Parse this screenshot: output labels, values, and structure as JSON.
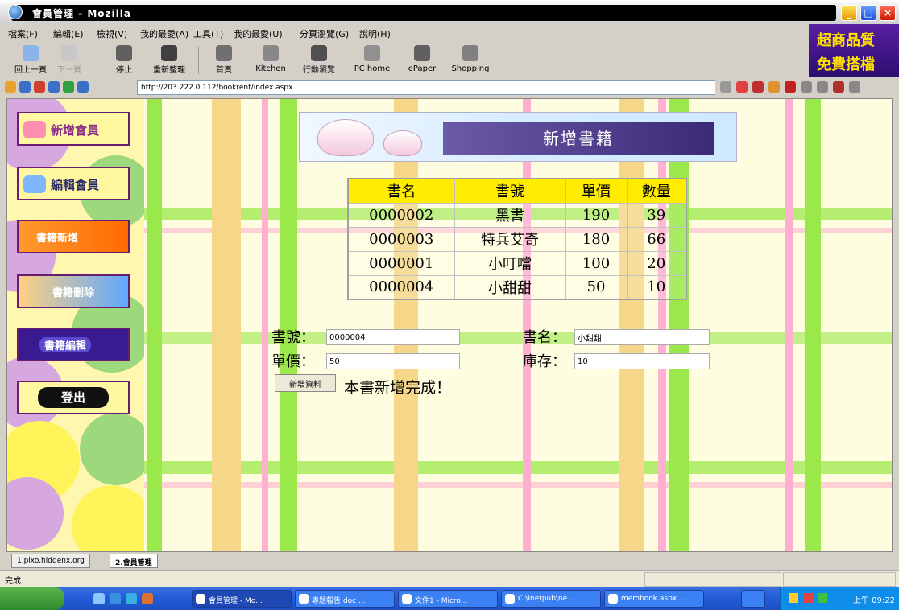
{
  "window": {
    "title": "會員管理 - Mozilla"
  },
  "menubar": {
    "items": [
      "檔案(F)",
      "編輯(E)",
      "檢視(V)",
      "我的最愛(A)",
      "工具(T)",
      "我的最愛(U)",
      "分頁瀏覽(G)",
      "說明(H)"
    ]
  },
  "ad": {
    "line1": "超商品質",
    "line2": "免費搭檔"
  },
  "toolbar": {
    "buttons": [
      "回上一頁",
      "下一頁",
      "停止",
      "重新整理",
      "首頁",
      "Kitchen",
      "行動瀏覽",
      "PC home",
      "ePaper",
      "Shopping"
    ]
  },
  "address": {
    "url": "http://203.222.0.112/bookrent/index.aspx"
  },
  "nav": {
    "items": [
      {
        "label": "新增會員",
        "color": "#ff8fb0"
      },
      {
        "label": "編輯會員",
        "color": "#7fb7ff"
      },
      {
        "label": "書籍新增",
        "color": "#ff7a00"
      },
      {
        "label": "書籍刪除",
        "color": "#5fa8ff"
      },
      {
        "label": "書籍編輯",
        "color": "#3a1a90"
      },
      {
        "label": "登出",
        "color": "#222222"
      }
    ]
  },
  "banner": {
    "title": "新增書籍"
  },
  "table": {
    "headers": [
      "書名",
      "書號",
      "單價",
      "數量"
    ],
    "rows": [
      [
        "0000002",
        "黑書",
        "190",
        "39"
      ],
      [
        "0000003",
        "特兵艾奇",
        "180",
        "66"
      ],
      [
        "0000001",
        "小叮噹",
        "100",
        "20"
      ],
      [
        "0000004",
        "小甜甜",
        "50",
        "10"
      ]
    ]
  },
  "form": {
    "book_no_label": "書號：",
    "book_no_value": "0000004",
    "book_name_label": "書名：",
    "book_name_value": "小甜甜",
    "price_label": "單價：",
    "price_value": "50",
    "stock_label": "庫存：",
    "stock_value": "10",
    "submit_label": "新增資料",
    "done_message": "本書新增完成！"
  },
  "tabs": [
    "1.pixo.hiddenx.org",
    "2.會員管理"
  ],
  "status": {
    "text": "完成"
  },
  "taskbar": {
    "tasks": [
      "會員管理 - Mo...",
      "專題報告.doc ...",
      "文件1 - Micro...",
      "C:\\Inetpub\\ne...",
      "membook.aspx ..."
    ],
    "clock": "上午 09:22"
  }
}
